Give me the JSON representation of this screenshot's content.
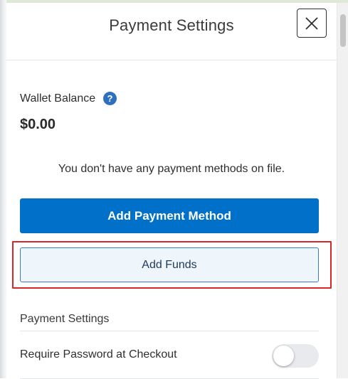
{
  "header": {
    "title": "Payment Settings",
    "close_icon": "close-icon"
  },
  "wallet": {
    "label": "Wallet Balance",
    "help_icon": "?",
    "balance": "$0.00"
  },
  "payment_methods": {
    "empty_message": "You don't have any payment methods on file.",
    "add_method_label": "Add Payment Method",
    "add_funds_label": "Add Funds"
  },
  "settings": {
    "section_title": "Payment Settings",
    "require_password_label": "Require Password at Checkout",
    "require_password_enabled": false
  },
  "colors": {
    "primary": "#0070c9",
    "highlight": "#d9262b",
    "help_icon": "#2e6fbf"
  }
}
